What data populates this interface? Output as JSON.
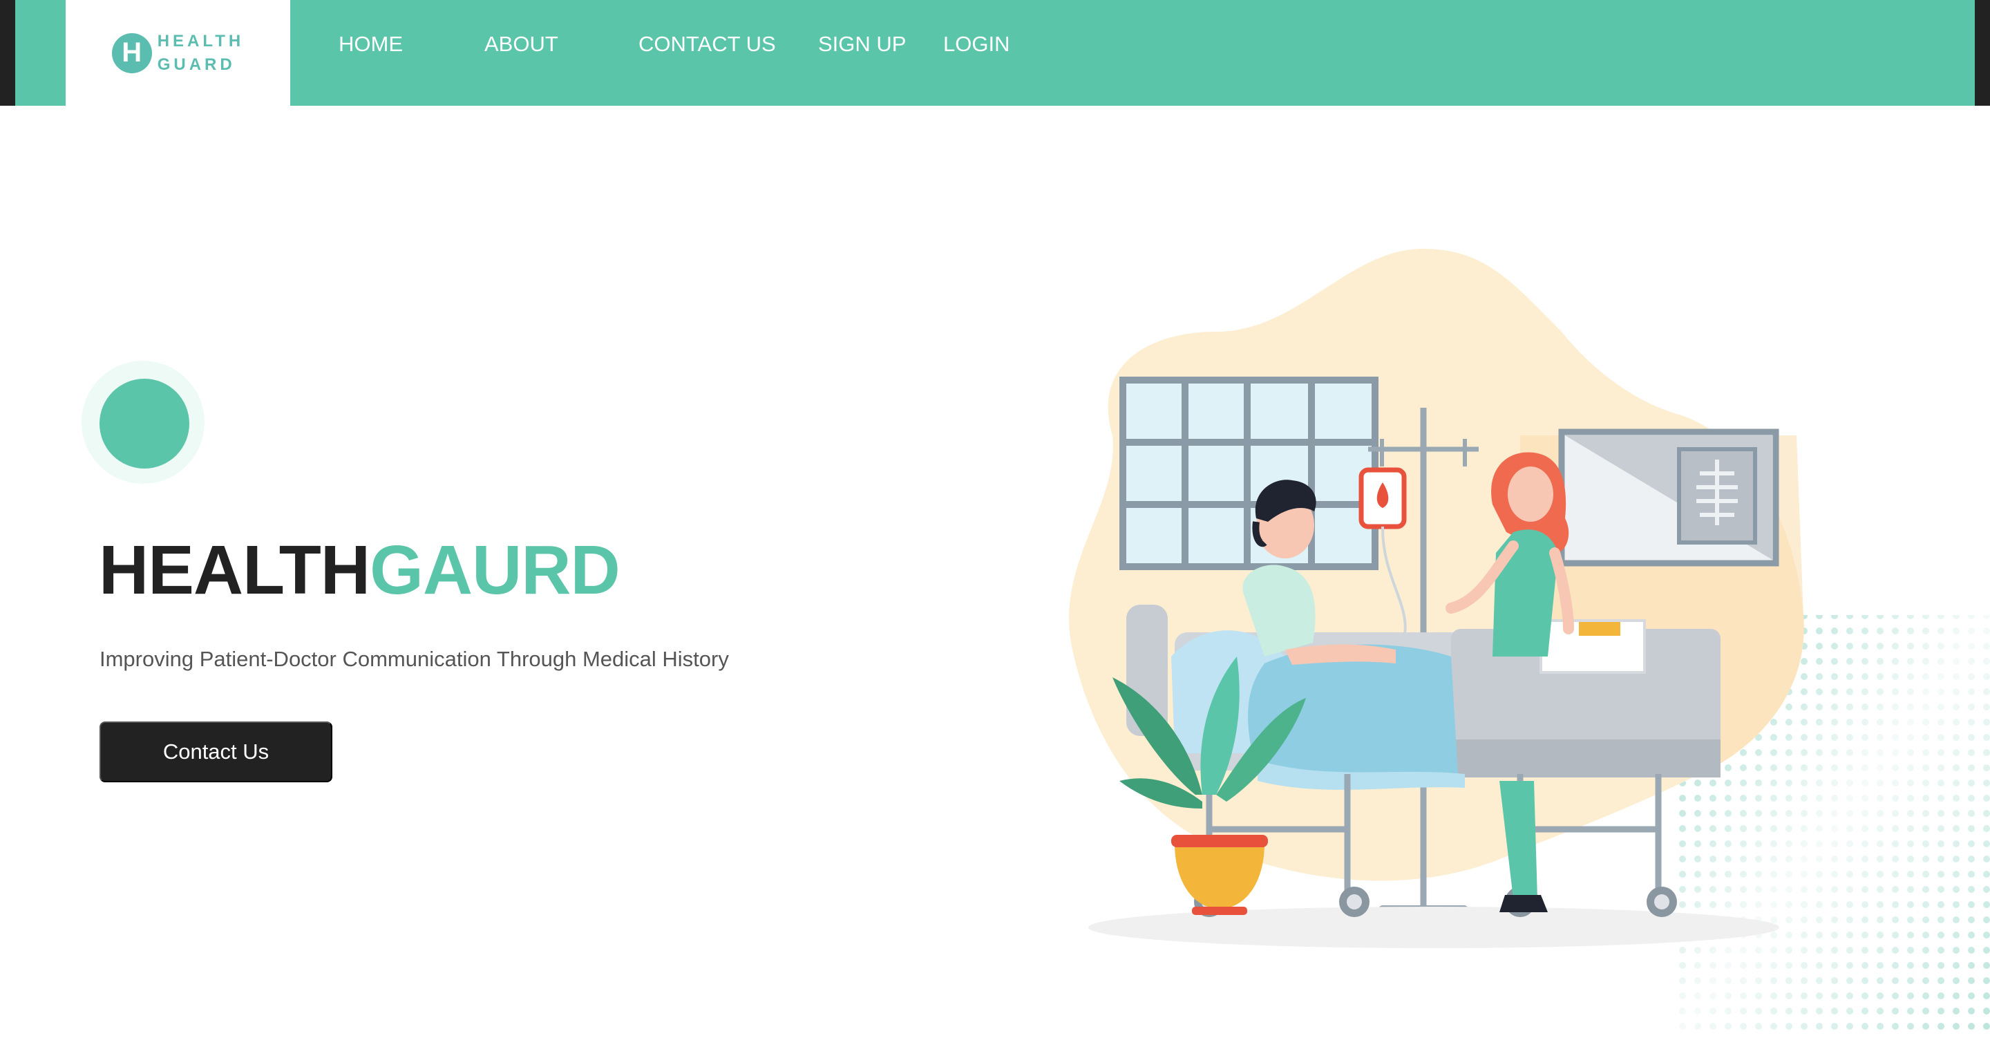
{
  "brand": {
    "initial": "H",
    "line1": "HEALTH",
    "line2": "GUARD"
  },
  "nav": {
    "items": [
      "HOME",
      "ABOUT",
      "CONTACT US",
      "SIGN UP",
      "LOGIN"
    ]
  },
  "hero": {
    "title_part1": "HEALTH",
    "title_part2": "GAURD",
    "subtitle": "Improving Patient-Doctor Communication Through Medical History",
    "cta_label": "Contact Us"
  },
  "colors": {
    "accent": "#5bc5a9",
    "dark": "#222222",
    "logo": "#5bbdb0"
  },
  "illustration": {
    "name": "hospital-bed-nurse-illustration"
  }
}
